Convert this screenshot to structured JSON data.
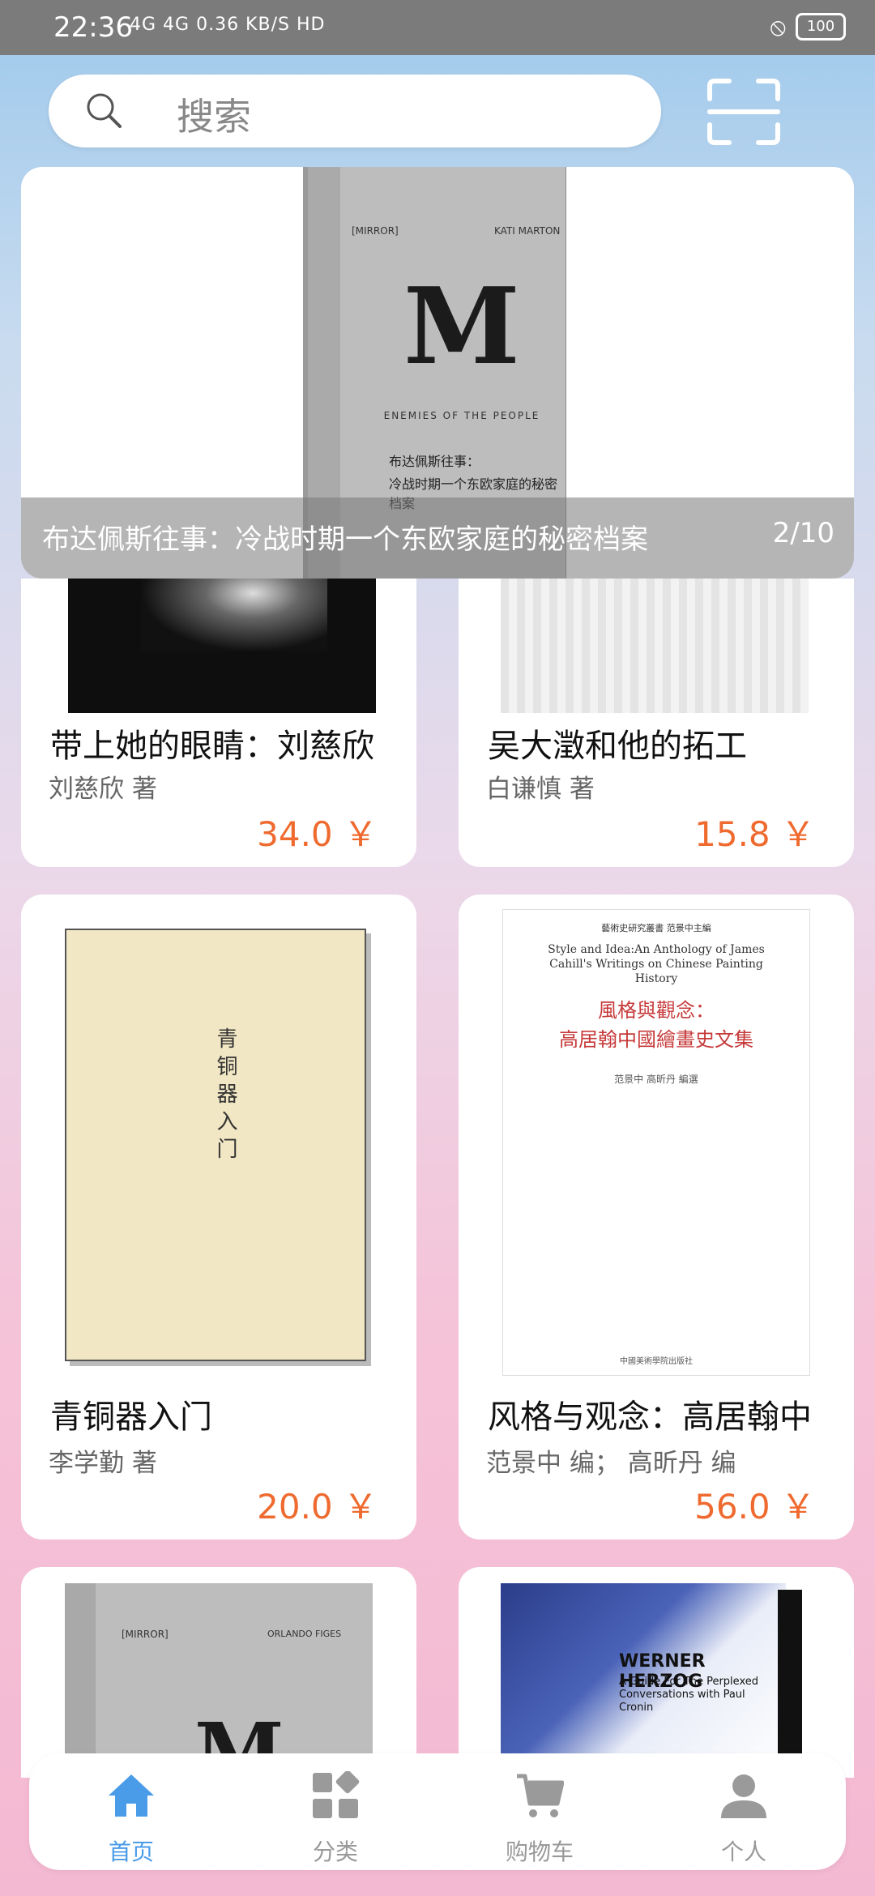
{
  "status": {
    "time": "22:36",
    "network": "4G 4G 0.36 KB/S HD",
    "battery": "100"
  },
  "search": {
    "placeholder": "搜索"
  },
  "banner": {
    "caption": "布达佩斯往事：冷战时期一个东欧家庭的秘密档案",
    "counter": "2/10",
    "cover": {
      "series": "[MIRROR]",
      "author_en": "KATI MARTON",
      "letter": "M",
      "tagline": "ENEMIES OF THE PEOPLE",
      "title_line1": "布达佩斯往事：",
      "title_line2": "冷战时期一个东欧家庭的秘密档案"
    }
  },
  "books": [
    {
      "title": "带上她的眼睛：刘慈欣",
      "author": "刘慈欣 著",
      "price": "34.0 ￥"
    },
    {
      "title": "吴大澂和他的拓工",
      "author": "白谦慎 著",
      "price": "15.8 ￥"
    },
    {
      "title": "青铜器入门",
      "author": "李学勤 著",
      "price": "20.0 ￥",
      "cover_title": "青铜器入门"
    },
    {
      "title": "风格与观念：高居翰中",
      "author": "范景中 编； 高昕丹 编",
      "price": "56.0 ￥",
      "cover_series": "藝術史研究叢書  范景中主編",
      "cover_en": "Style and Idea:An Anthology of James Cahill's Writings on Chinese Painting History",
      "cover_cn1": "風格與觀念：",
      "cover_cn2": "高居翰中國繪畫史文集",
      "cover_editors": "范景中  高昕丹  編選",
      "cover_publisher": "中國美術學院出版社"
    },
    {
      "title": "",
      "author": "",
      "price": "",
      "cover_series": "[MIRROR]",
      "cover_author_en": "ORLANDO FIGES",
      "cover_letter": "M"
    },
    {
      "title": "",
      "author": "",
      "price": "",
      "cover_name": "WERNER HERZOG",
      "cover_sub": "A Guide For The Perplexed Conversations with Paul Cronin"
    }
  ],
  "nav": [
    {
      "label": "首页",
      "icon": "home-icon",
      "active": true
    },
    {
      "label": "分类",
      "icon": "category-icon",
      "active": false
    },
    {
      "label": "购物车",
      "icon": "cart-icon",
      "active": false
    },
    {
      "label": "个人",
      "icon": "person-icon",
      "active": false
    }
  ],
  "colors": {
    "accent": "#4a9be8",
    "price": "#ef6a2f",
    "status_bar": "#7b7b7b"
  }
}
